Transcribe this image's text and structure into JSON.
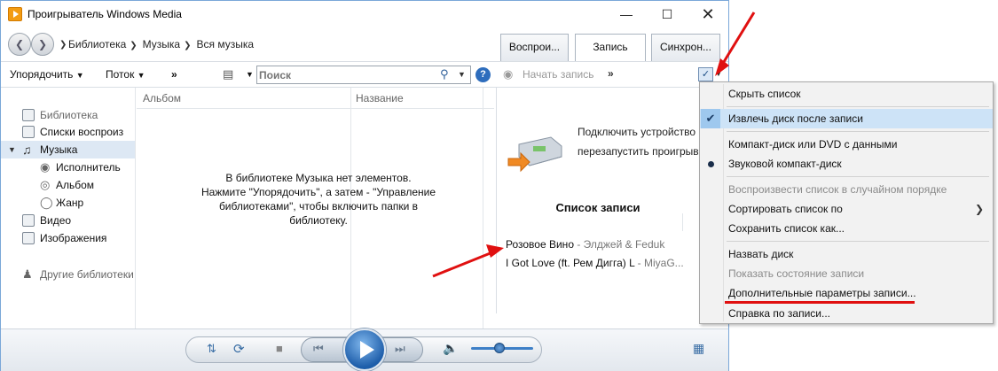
{
  "window": {
    "title": "Проигрыватель Windows Media"
  },
  "nav": {
    "breadcrumb": [
      "Библиотека",
      "Музыка",
      "Вся музыка"
    ],
    "tabs": [
      "Воспрои...",
      "Запись",
      "Синхрон..."
    ]
  },
  "toolbar": {
    "organize": "Упорядочить",
    "stream": "Поток",
    "more": "»",
    "search_placeholder": "Поиск"
  },
  "columns": {
    "album": "Альбом",
    "name": "Название"
  },
  "sidebar": {
    "items": [
      {
        "label": "Библиотека",
        "icon": "library-icon"
      },
      {
        "label": "Списки воспроиз",
        "icon": "playlists-icon"
      },
      {
        "label": "Музыка",
        "icon": "music-icon"
      },
      {
        "label": "Исполнитель",
        "icon": "artist-icon"
      },
      {
        "label": "Альбом",
        "icon": "album-icon"
      },
      {
        "label": "Жанр",
        "icon": "genre-icon"
      },
      {
        "label": "Видео",
        "icon": "video-icon"
      },
      {
        "label": "Изображения",
        "icon": "pictures-icon"
      },
      {
        "label": "Другие библиотеки",
        "icon": "other-libraries-icon"
      }
    ]
  },
  "library": {
    "empty_line1": "В библиотеке Музыка нет элементов.",
    "empty_line2": "Нажмите \"Упорядочить\", а затем - \"Управление",
    "empty_line3": "библиотеками\", чтобы включить папки в",
    "empty_line4": "библиотеку."
  },
  "burn": {
    "start_burn": "Начать запись",
    "more": "»",
    "connect_line1": "Подключить устройство",
    "connect_line2": "перезапустить проигрыв",
    "list_title": "Список записи",
    "items": [
      {
        "title": "Розовое Вино",
        "artist": " - Элджей & Feduk"
      },
      {
        "title": "I Got Love (ft. Рем Дигга) L",
        "artist": " - MiyaG..."
      }
    ]
  },
  "menu": {
    "items": [
      {
        "label": "Скрыть список",
        "state": "normal"
      },
      {
        "label": "Извлечь диск после записи",
        "state": "checked"
      },
      {
        "label": "Компакт-диск или DVD с данными",
        "state": "normal"
      },
      {
        "label": "Звуковой компакт-диск",
        "state": "bullet"
      },
      {
        "label": "Воспроизвести список в случайном порядке",
        "state": "disabled"
      },
      {
        "label": "Сортировать список по",
        "state": "submenu"
      },
      {
        "label": "Сохранить список как...",
        "state": "normal"
      },
      {
        "label": "Назвать диск",
        "state": "normal"
      },
      {
        "label": "Показать состояние записи",
        "state": "disabled"
      },
      {
        "label": "Дополнительные параметры записи...",
        "state": "normal"
      },
      {
        "label": "Справка по записи...",
        "state": "normal"
      }
    ]
  },
  "colors": {
    "accent": "#2e6dbd",
    "annotation": "#e01010",
    "menu_bg": "#f2f2f2"
  },
  "player": {
    "volume_fraction": 0.45
  }
}
